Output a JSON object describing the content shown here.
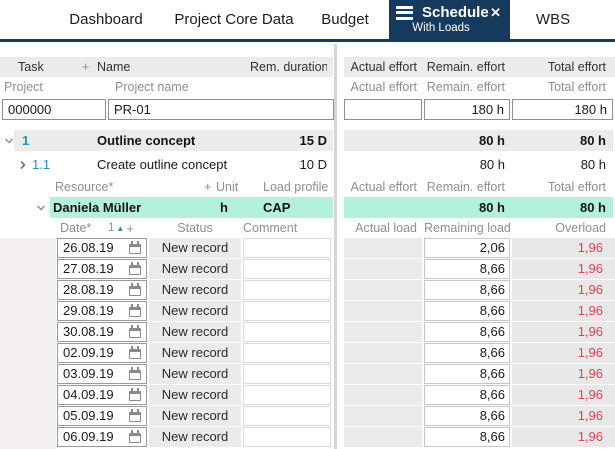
{
  "tab_bar": {
    "tabs": [
      {
        "label": "Dashboard",
        "active": false
      },
      {
        "label": "Project Core Data",
        "active": false
      },
      {
        "label": "Budget",
        "active": false
      },
      {
        "label": "Schedule",
        "active": true,
        "subtitle": "With Loads"
      },
      {
        "label": "WBS",
        "active": false
      }
    ]
  },
  "icons": {
    "close": "✕",
    "sort_ascending": "▲"
  },
  "table": {
    "main_header": {
      "task": "Task",
      "plus": "+",
      "name": "Name",
      "rem_duration": "Rem. duration",
      "actual_effort": "Actual effort",
      "remain_effort": "Remain. effort",
      "total_effort": "Total effort"
    },
    "project_header": {
      "project": "Project",
      "project_name": "Project name",
      "actual_effort": "Actual effort",
      "remain_effort": "Remain. effort",
      "total_effort": "Total effort"
    },
    "project_row": {
      "id": "000000",
      "name": "PR-01",
      "actual_effort": "",
      "remain_effort": "180 h",
      "total_effort": "180 h"
    },
    "task_rows": [
      {
        "number": "1",
        "name": "Outline concept",
        "rem_duration": "15 D",
        "actual_effort": "",
        "remain_effort": "80 h",
        "total_effort": "80 h"
      },
      {
        "number": "1.1",
        "name": "Create outline concept",
        "rem_duration": "10 D",
        "actual_effort": "",
        "remain_effort": "80 h",
        "total_effort": "80 h"
      }
    ],
    "resource_header": {
      "resource": "Resource*",
      "plus": "+",
      "unit": "Unit",
      "load_profile": "Load profile",
      "actual_effort": "Actual effort",
      "remain_effort": "Remain. effort",
      "total_effort": "Total effort"
    },
    "resource_row": {
      "name": "Daniela Müller",
      "unit": "h",
      "load_profile": "CAP",
      "actual_effort": "",
      "remain_effort": "80 h",
      "total_effort": "80 h"
    },
    "load_header": {
      "date": "Date*",
      "sort_number": "1",
      "plus": "+",
      "status": "Status",
      "comment": "Comment",
      "actual_load": "Actual load",
      "remaining_load": "Remaining load",
      "overload": "Overload"
    },
    "load_rows": [
      {
        "date": "26.08.19",
        "status": "New record",
        "comment": "",
        "actual_load": "",
        "remaining_load": "2,06",
        "overload": "1,96"
      },
      {
        "date": "27.08.19",
        "status": "New record",
        "comment": "",
        "actual_load": "",
        "remaining_load": "8,66",
        "overload": "1,96"
      },
      {
        "date": "28.08.19",
        "status": "New record",
        "comment": "",
        "actual_load": "",
        "remaining_load": "8,66",
        "overload": "1,96"
      },
      {
        "date": "29.08.19",
        "status": "New record",
        "comment": "",
        "actual_load": "",
        "remaining_load": "8,66",
        "overload": "1,96"
      },
      {
        "date": "30.08.19",
        "status": "New record",
        "comment": "",
        "actual_load": "",
        "remaining_load": "8,66",
        "overload": "1,96"
      },
      {
        "date": "02.09.19",
        "status": "New record",
        "comment": "",
        "actual_load": "",
        "remaining_load": "8,66",
        "overload": "1,96"
      },
      {
        "date": "03.09.19",
        "status": "New record",
        "comment": "",
        "actual_load": "",
        "remaining_load": "8,66",
        "overload": "1,96"
      },
      {
        "date": "04.09.19",
        "status": "New record",
        "comment": "",
        "actual_load": "",
        "remaining_load": "8,66",
        "overload": "1,96"
      },
      {
        "date": "05.09.19",
        "status": "New record",
        "comment": "",
        "actual_load": "",
        "remaining_load": "8,66",
        "overload": "1,96"
      },
      {
        "date": "06.09.19",
        "status": "New record",
        "comment": "",
        "actual_load": "",
        "remaining_load": "8,66",
        "overload": "1,96"
      }
    ]
  },
  "colors": {
    "accent_navy": "#16395e",
    "accent_blue": "#1d8fc9",
    "highlight_mint": "#b2f1dc",
    "overload_red": "#e8404e",
    "row_gray": "#ebebeb"
  }
}
